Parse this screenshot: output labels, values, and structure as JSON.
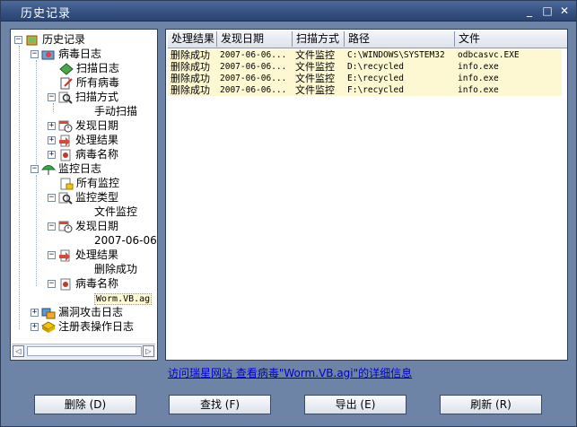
{
  "window": {
    "title": "历史记录",
    "minimize": "_",
    "maximize": "□",
    "close": "✕"
  },
  "tree": {
    "root": "历史记录",
    "virus_log": "病毒日志",
    "scan_log": "扫描日志",
    "all_virus": "所有病毒",
    "scan_method": "扫描方式",
    "manual_scan": "手动扫描",
    "discover_date": "发现日期",
    "process_result": "处理结果",
    "virus_name": "病毒名称",
    "monitor_log": "监控日志",
    "all_monitor": "所有监控",
    "monitor_type": "监控类型",
    "file_monitor": "文件监控",
    "m_discover_date": "发现日期",
    "m_date_value": "2007-06-06",
    "m_process_result": "处理结果",
    "m_delete_success": "删除成功",
    "m_virus_name": "病毒名称",
    "m_virus_value": "Worm.VB.ag",
    "vuln_log": "漏洞攻击日志",
    "registry_log": "注册表操作日志"
  },
  "scrollbar": {
    "left_arrow": "◁",
    "right_arrow": "▷"
  },
  "list": {
    "columns": [
      "处理结果",
      "发现日期",
      "扫描方式",
      "路径",
      "文件"
    ],
    "rows": [
      [
        "删除成功",
        "2007-06-06...",
        "文件监控",
        "C:\\WINDOWS\\SYSTEM32",
        "odbcasvc.EXE"
      ],
      [
        "删除成功",
        "2007-06-06...",
        "文件监控",
        "D:\\recycled",
        "info.exe"
      ],
      [
        "删除成功",
        "2007-06-06...",
        "文件监控",
        "E:\\recycled",
        "info.exe"
      ],
      [
        "删除成功",
        "2007-06-06...",
        "文件监控",
        "F:\\recycled",
        "info.exe"
      ]
    ]
  },
  "info_link": "访问瑞星网站 查看病毒\"Worm.VB.agi\"的详细信息",
  "buttons": {
    "delete": "删除 (D)",
    "find": "查找 (F)",
    "export": "导出 (E)",
    "refresh": "刷新 (R)"
  },
  "colors": {
    "window_bg": "#6e84a6",
    "row_highlight": "#fdf8d2",
    "link": "#0000cc"
  }
}
